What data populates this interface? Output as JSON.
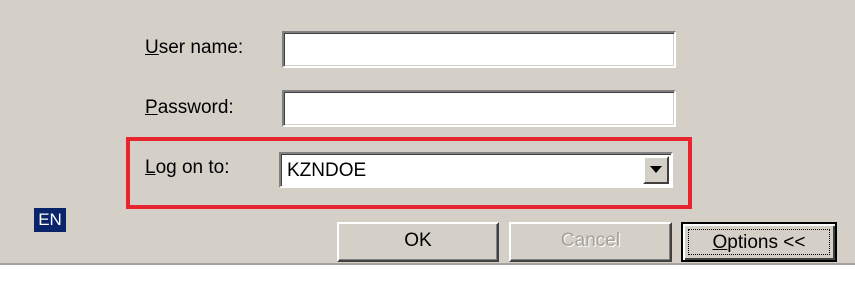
{
  "form": {
    "username_label_key": "U",
    "username_label_rest": "ser name:",
    "username_value": "",
    "password_label_key": "P",
    "password_label_rest": "assword:",
    "password_value": "",
    "logon_label_key": "L",
    "logon_label_rest": "og on to:",
    "logon_value": "KZNDOE"
  },
  "language_indicator": "EN",
  "buttons": {
    "ok": "OK",
    "cancel": "Cancel",
    "options_key": "O",
    "options_rest": "ptions <<"
  },
  "colors": {
    "highlight": "#e8242e",
    "dialog_bg": "#d4d0c8",
    "language_bg": "#0a246a"
  },
  "icons": {
    "combo_arrow": "chevron-down-icon"
  }
}
